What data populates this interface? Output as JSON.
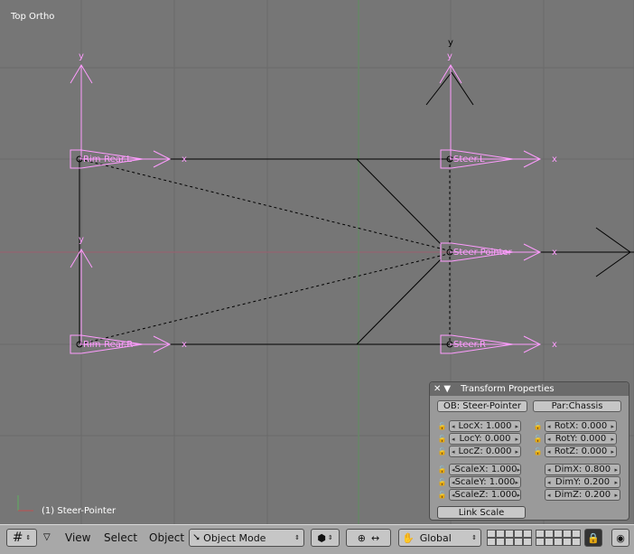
{
  "viewport": {
    "title": "Top Ortho",
    "status": "(1) Steer-Pointer",
    "colors": {
      "background": "#767676",
      "grid": "#6a6a6a",
      "bone": "#ff9cff",
      "x_axis": "#9c5f6f",
      "y_axis": "#5f8f5f"
    },
    "labels": {
      "rim_rear_l": "Rim-Rear.L",
      "rim_rear_r": "Rim-Rear.R",
      "steer_l": "Steer.L",
      "steer_r": "Steer.R",
      "steer_pointer": "Steer-Pointer",
      "x": "x",
      "y": "y"
    }
  },
  "panel": {
    "title": "Transform Properties",
    "ob": "OB: Steer-Pointer",
    "par": "Par:Chassis",
    "loc": [
      "LocX: 1.000",
      "LocY: 0.000",
      "LocZ: 0.000"
    ],
    "rot": [
      "RotX: 0.000",
      "RotY: 0.000",
      "RotZ: 0.000"
    ],
    "scale": [
      "ScaleX: 1.000",
      "ScaleY: 1.000",
      "ScaleZ: 1.000"
    ],
    "dim": [
      "DimX: 0.800",
      "DimY: 0.200",
      "DimZ: 0.200"
    ],
    "link_scale": "Link Scale"
  },
  "header": {
    "menus": [
      "View",
      "Select",
      "Object"
    ],
    "mode": "Object Mode",
    "orientation": "Global"
  }
}
